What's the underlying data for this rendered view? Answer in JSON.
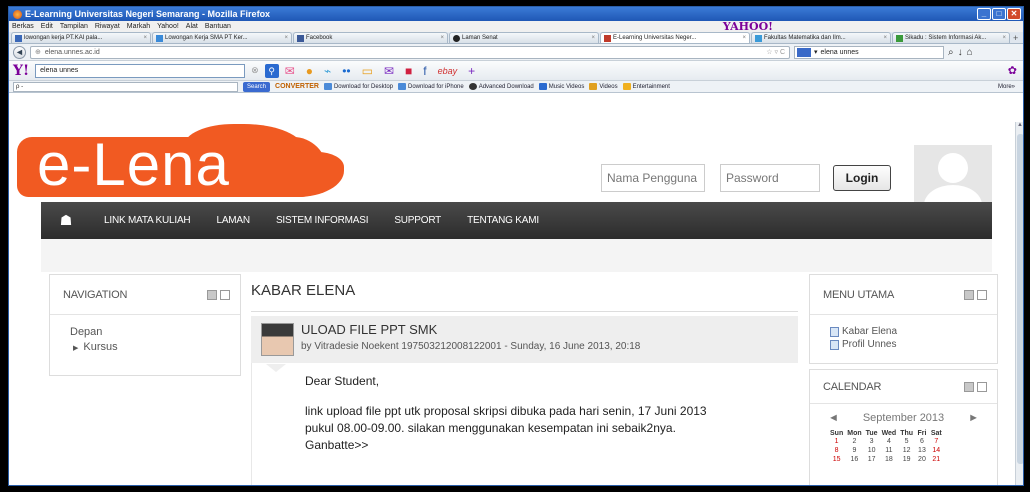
{
  "browser": {
    "title": "E-Learning Universitas Negeri Semarang - Mozilla Firefox",
    "menu": [
      "Berkas",
      "Edit",
      "Tampilan",
      "Riwayat",
      "Markah",
      "Yahoo!",
      "Alat",
      "Bantuan"
    ],
    "yahoo_brand": "YAHOO!",
    "tabs": [
      {
        "label": "lowongan kerja PT.KAI pala..."
      },
      {
        "label": "Lowongan Kerja SMA PT Ker..."
      },
      {
        "label": "Facebook"
      },
      {
        "label": "Laman Senat"
      },
      {
        "label": "E-Learning Universitas Neger..."
      },
      {
        "label": "Fakultas Matematika dan Ilm..."
      },
      {
        "label": "Sikadu : Sistem Informasi Ak..."
      }
    ],
    "url": "elena.unnes.ac.id",
    "nav_search_value": "elena unnes",
    "yahoo_search_value": "elena unnes",
    "search_toolbar": {
      "placeholder": "ρ -",
      "search_btn": "Search",
      "converter": "CONVERTER",
      "items": [
        "Download for Desktop",
        "Download for iPhone",
        "Advanced Download",
        "Music Videos",
        "Videos",
        "Entertainment"
      ],
      "more": "More»"
    },
    "yahoo_icons": [
      "✉",
      "●",
      "⌁",
      "••",
      "▭",
      "✉",
      "■",
      "f",
      "ebay",
      "+"
    ]
  },
  "site": {
    "logo": "e-Lena",
    "username_placeholder": "Nama Pengguna",
    "password_placeholder": "Password",
    "login_label": "Login",
    "nav": [
      "LINK MATA KULIAH",
      "LAMAN",
      "SISTEM INFORMASI",
      "SUPPORT",
      "TENTANG KAMI"
    ],
    "navigation_block": {
      "title": "NAVIGATION",
      "items": [
        "Depan",
        "Kursus"
      ]
    },
    "main": {
      "title": "KABAR ELENA",
      "post": {
        "title": "ULOAD FILE PPT SMK",
        "meta": "by Vitradesie Noekent 197503212008122001 - Sunday, 16 June 2013, 20:18",
        "greeting": "Dear Student,",
        "body_line1": "link upload file ppt utk proposal skripsi dibuka pada hari senin, 17 Juni 2013",
        "body_line2": "pukul 08.00-09.00.  silakan menggunakan kesempatan ini sebaik2nya.",
        "body_line3": "Ganbatte>>"
      }
    },
    "menu_utama": {
      "title": "MENU UTAMA",
      "items": [
        "Kabar Elena",
        "Profil Unnes"
      ]
    },
    "calendar": {
      "title": "CALENDAR",
      "month": "September 2013",
      "prev": "◄",
      "next": "►",
      "days": [
        "Sun",
        "Mon",
        "Tue",
        "Wed",
        "Thu",
        "Fri",
        "Sat"
      ],
      "weeks": [
        [
          "1",
          "2",
          "3",
          "4",
          "5",
          "6",
          "7"
        ],
        [
          "8",
          "9",
          "10",
          "11",
          "12",
          "13",
          "14"
        ],
        [
          "15",
          "16",
          "17",
          "18",
          "19",
          "20",
          "21"
        ]
      ]
    }
  }
}
